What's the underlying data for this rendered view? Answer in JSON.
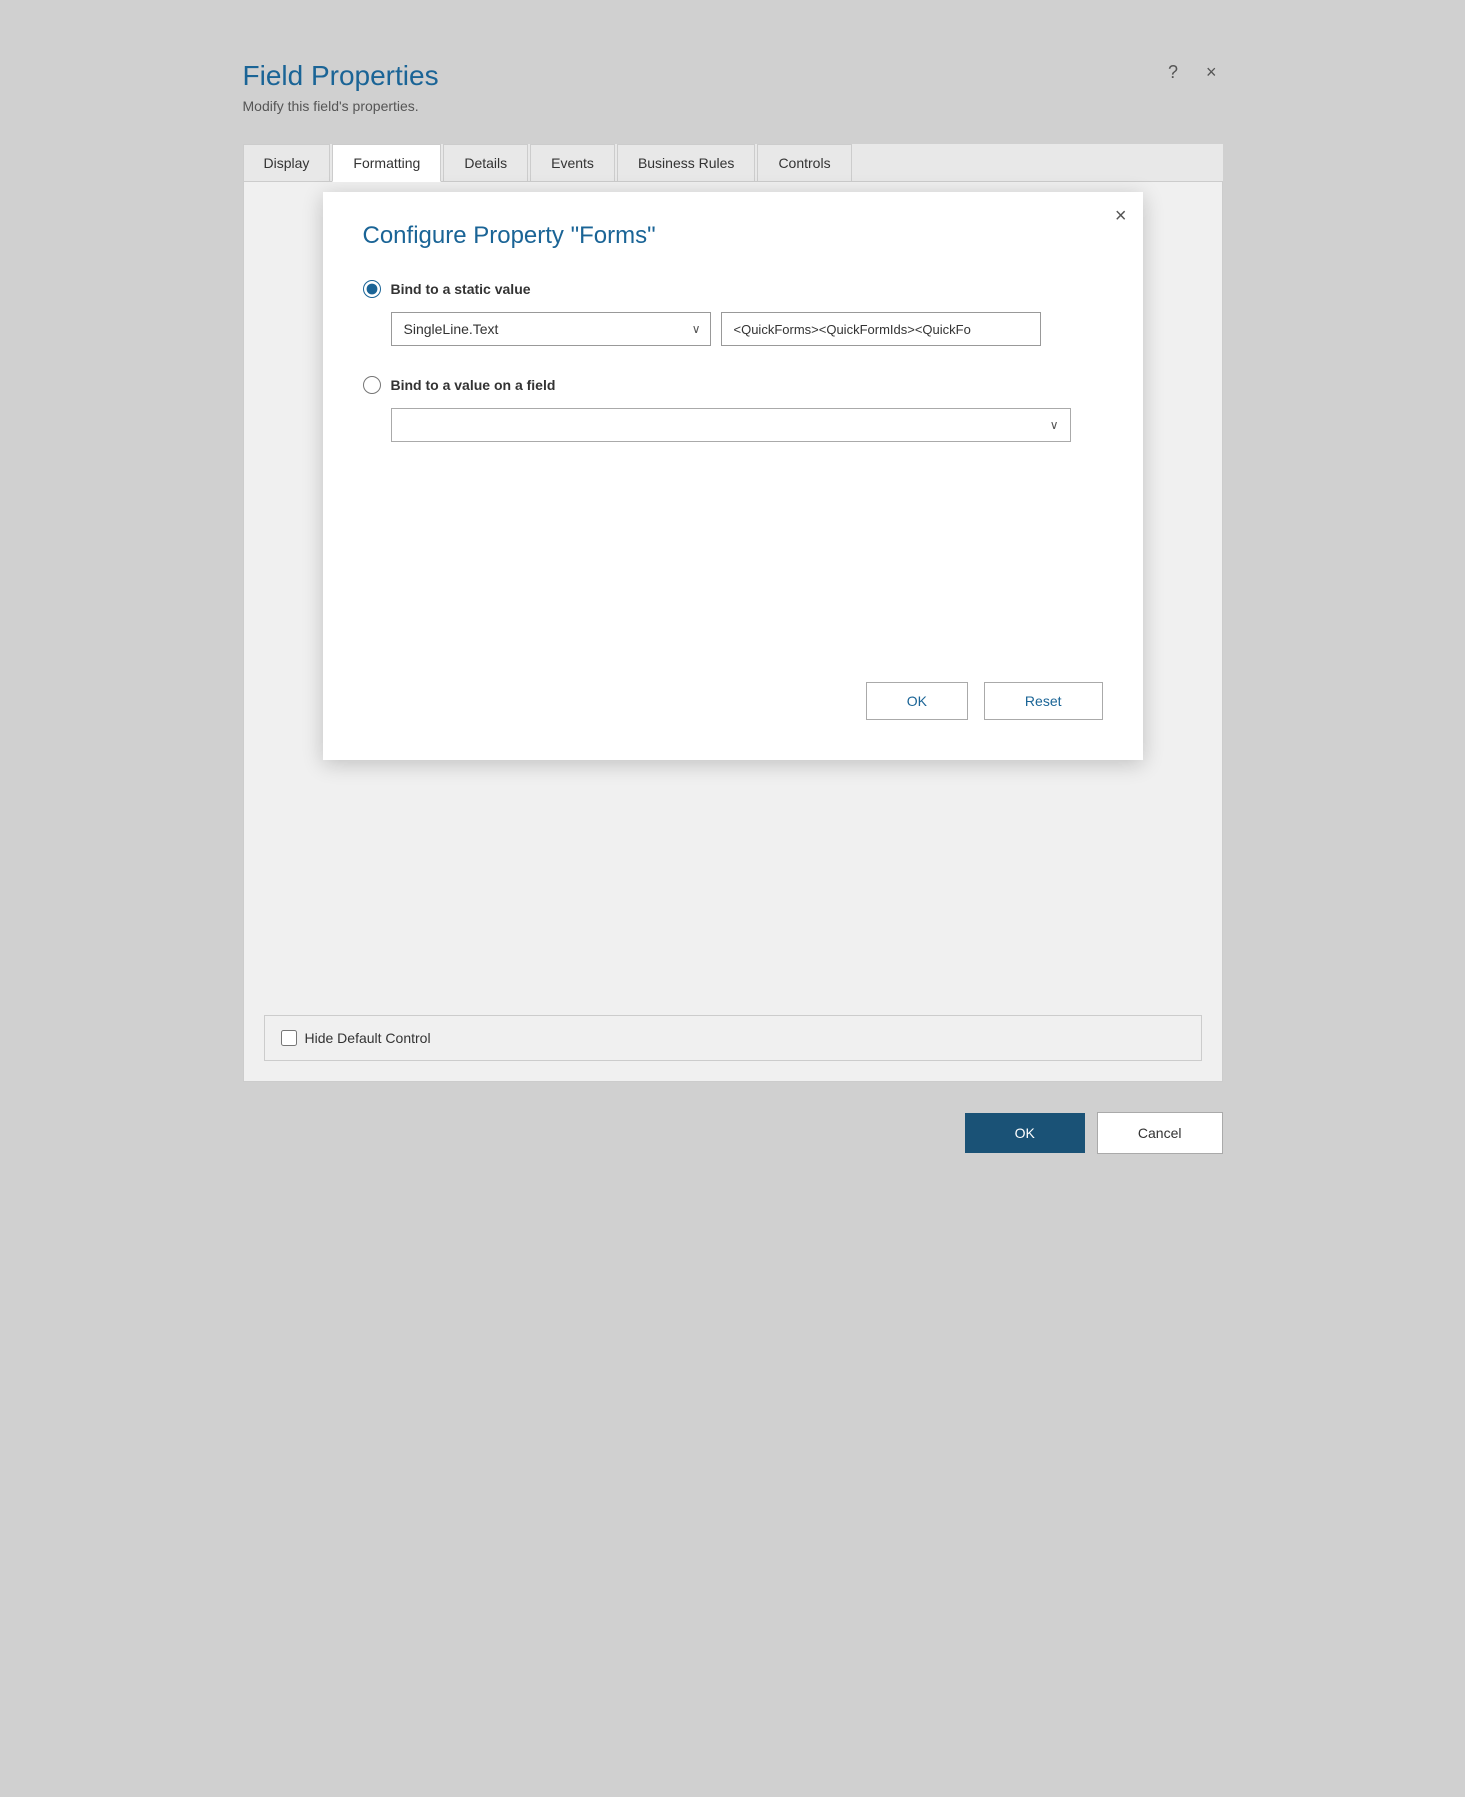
{
  "page": {
    "title": "Field Properties",
    "subtitle": "Modify this field's properties.",
    "help_icon": "?",
    "close_icon": "×"
  },
  "tabs": [
    {
      "id": "display",
      "label": "Display",
      "active": false
    },
    {
      "id": "formatting",
      "label": "Formatting",
      "active": true
    },
    {
      "id": "details",
      "label": "Details",
      "active": false
    },
    {
      "id": "events",
      "label": "Events",
      "active": false
    },
    {
      "id": "business-rules",
      "label": "Business Rules",
      "active": false
    },
    {
      "id": "controls",
      "label": "Controls",
      "active": false
    }
  ],
  "modal": {
    "close_icon": "×",
    "title": "Configure Property \"Forms\"",
    "static_value_label": "Bind to a static value",
    "type_dropdown_value": "SingleLine.Text",
    "value_input_value": "<QuickForms><QuickFormIds><QuickFo",
    "field_value_label": "Bind to a value on a field",
    "field_dropdown_placeholder": "",
    "ok_label": "OK",
    "reset_label": "Reset"
  },
  "bottom": {
    "hide_default_label": "Hide Default Control"
  },
  "footer": {
    "ok_label": "OK",
    "cancel_label": "Cancel"
  }
}
